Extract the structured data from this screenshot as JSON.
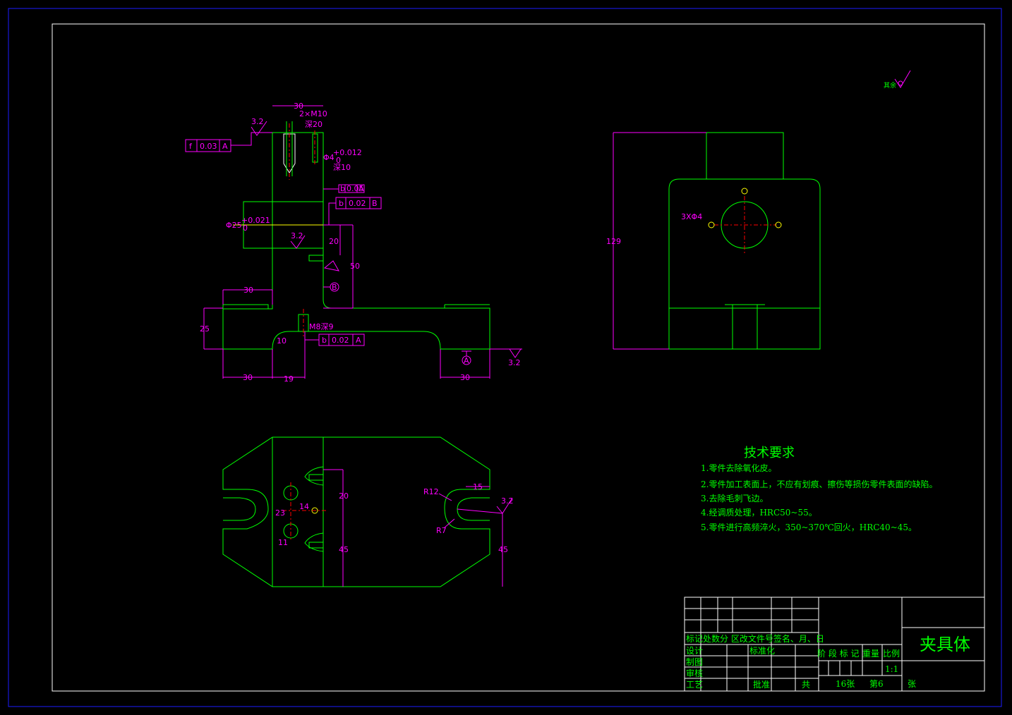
{
  "drawing": {
    "tech_requirements": {
      "title": "技术要求",
      "items": [
        "1.零件去除氧化皮。",
        "2.零件加工表面上，不应有划痕、擦伤等损伤零件表面的缺陷。",
        "3.去除毛刺飞边。",
        "4.经调质处理，HRC50~55。",
        "5.零件进行高频淬火，350~370℃回火，HRC40~45。"
      ]
    },
    "title_block": {
      "part_name": "夹具体",
      "row_header": "标记处数分  区改文件号签名、月、日",
      "standardization": "标准化",
      "stage_header": "阶 段 标 记",
      "weight": "重量",
      "scale_label": "比例",
      "scale_value": "1:1",
      "designer": "设计",
      "drafter": "制图",
      "reviewer": "审核",
      "process": "工艺",
      "approve": "批准",
      "total": "共",
      "sheets": "16张",
      "sheet_no": "第6",
      "zhang": "张"
    },
    "roughness_other": "其余",
    "front_view": {
      "dim_30_top": "30",
      "thread": "2×M10",
      "depth20": "深20",
      "pin_hole": "Φ4",
      "tol_upper": "+0.012",
      "tol_zero": "0",
      "depth10": "深10",
      "fcf_top": [
        "f",
        "0.03",
        "A"
      ],
      "fcf_small": [
        "b",
        "0.05",
        "A"
      ],
      "fcf_mid": [
        "b",
        "0.02",
        "B"
      ],
      "bore": "Φ25",
      "bore_tol_upper": "+0.021",
      "bore_tol_zero": "0",
      "rough_32": "3.2",
      "dim_20": "20",
      "dim_50": "50",
      "datum_b": "B",
      "dim_30_left": "30",
      "dim_25": "25",
      "tap": "M8深9",
      "fcf_bottom": [
        "b",
        "0.02",
        "A"
      ],
      "dim_10": "10",
      "datum_a": "A",
      "dim_30_bl": "30",
      "dim_19": "19",
      "dim_30_br": "30",
      "rough_small": "3.2"
    },
    "side_view": {
      "dim_129": "129",
      "holes": "3XΦ4"
    },
    "top_view": {
      "dim_20": "20",
      "dim_14": "14",
      "dim_23": "23",
      "dim_11": "11",
      "dim_45": "45",
      "r12": "R12",
      "r7": "R7",
      "dim_15": "15",
      "dim_45b": "45",
      "rough": "3.2"
    }
  }
}
